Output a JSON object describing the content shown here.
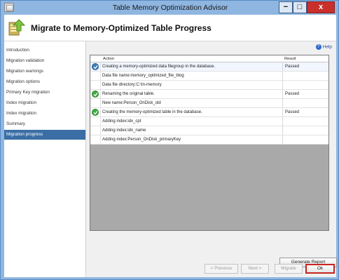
{
  "window": {
    "title": "Table Memory Optimization Advisor",
    "min_label": "−",
    "max_label": "□",
    "close_label": "x"
  },
  "header": {
    "title": "Migrate to Memory-Optimized Table Progress"
  },
  "sidebar": {
    "items": [
      {
        "label": "Introduction"
      },
      {
        "label": "Migration validation"
      },
      {
        "label": "Migration warnings"
      },
      {
        "label": "Migration options"
      },
      {
        "label": "Primary Key migration"
      },
      {
        "label": "Index migration"
      },
      {
        "label": "Index migration"
      },
      {
        "label": "Summary"
      },
      {
        "label": "Migration progress"
      }
    ],
    "selected_index": 8
  },
  "help": {
    "label": "Help",
    "icon": "help-icon"
  },
  "grid": {
    "columns": {
      "action": "Action",
      "result": "Result"
    },
    "rows": [
      {
        "action": "Creating a memory-optimized data filegroup in the database.",
        "result": "Passed",
        "icon": "check-icon"
      },
      {
        "action": "Data file name:memory_optimized_file_blog",
        "result": "",
        "icon": ""
      },
      {
        "action": "Data file directory:C:\\In-memory",
        "result": "",
        "icon": ""
      },
      {
        "action": "Renaming the original table.",
        "result": "Passed",
        "icon": "check-icon"
      },
      {
        "action": "New name:Person_OnDisk_old",
        "result": "",
        "icon": ""
      },
      {
        "action": "Creating the memory-optimized table in the database.",
        "result": "Passed",
        "icon": "check-icon"
      },
      {
        "action": "Adding index:idx_cpt",
        "result": "",
        "icon": ""
      },
      {
        "action": "Adding index:idx_name",
        "result": "",
        "icon": ""
      },
      {
        "action": "Adding index:Person_OnDisk_primaryKey",
        "result": "",
        "icon": ""
      }
    ]
  },
  "buttons": {
    "generate_report": "Generate Report",
    "previous": "< Previous",
    "next": "Next >",
    "migrate": "Migrate",
    "ok": "Ok"
  },
  "colors": {
    "selected": "#3a6ea5",
    "passed_icon": "#3fae3f",
    "ok_border": "#c8231f"
  }
}
